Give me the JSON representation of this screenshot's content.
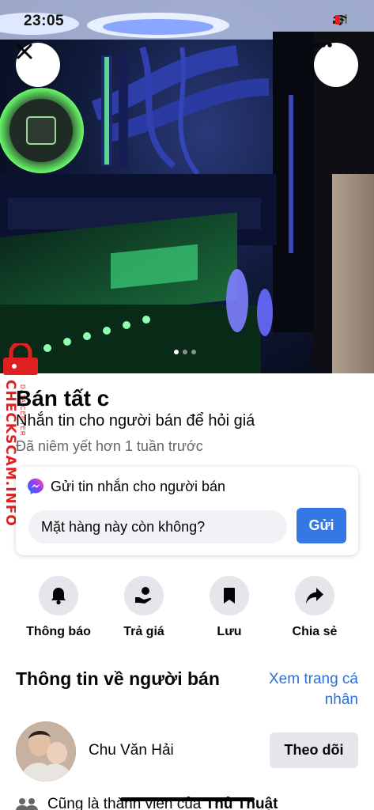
{
  "status_bar": {
    "time": "23:05"
  },
  "hero": {
    "pager_count": 3,
    "pager_active": 0
  },
  "watermark": {
    "text": "CHECKSCAM.INFO",
    "sub": "DATA CENTER"
  },
  "listing": {
    "title": "Bán tất c",
    "subtitle": "Nhắn tin cho người bán để hỏi giá",
    "listed_time": "Đã niêm yết hơn 1 tuần trước"
  },
  "message_card": {
    "heading": "Gửi tin nhắn cho người bán",
    "input_value": "Mặt hàng này còn không?",
    "send_label": "Gửi"
  },
  "actions": [
    {
      "label": "Thông báo",
      "icon": "bell-icon"
    },
    {
      "label": "Trả giá",
      "icon": "offer-hand-icon"
    },
    {
      "label": "Lưu",
      "icon": "bookmark-icon"
    },
    {
      "label": "Chia sẻ",
      "icon": "share-icon"
    }
  ],
  "seller": {
    "section_title": "Thông tin về người bán",
    "profile_link": "Xem trang cá nhân",
    "name": "Chu Văn Hải",
    "follow_label": "Theo dõi",
    "member_prefix": "Cũng là thành viên của",
    "member_group": "Thủ Thuật"
  },
  "colors": {
    "accent": "#3578e5",
    "link": "#2e6fd9",
    "watermark": "#e02020"
  }
}
